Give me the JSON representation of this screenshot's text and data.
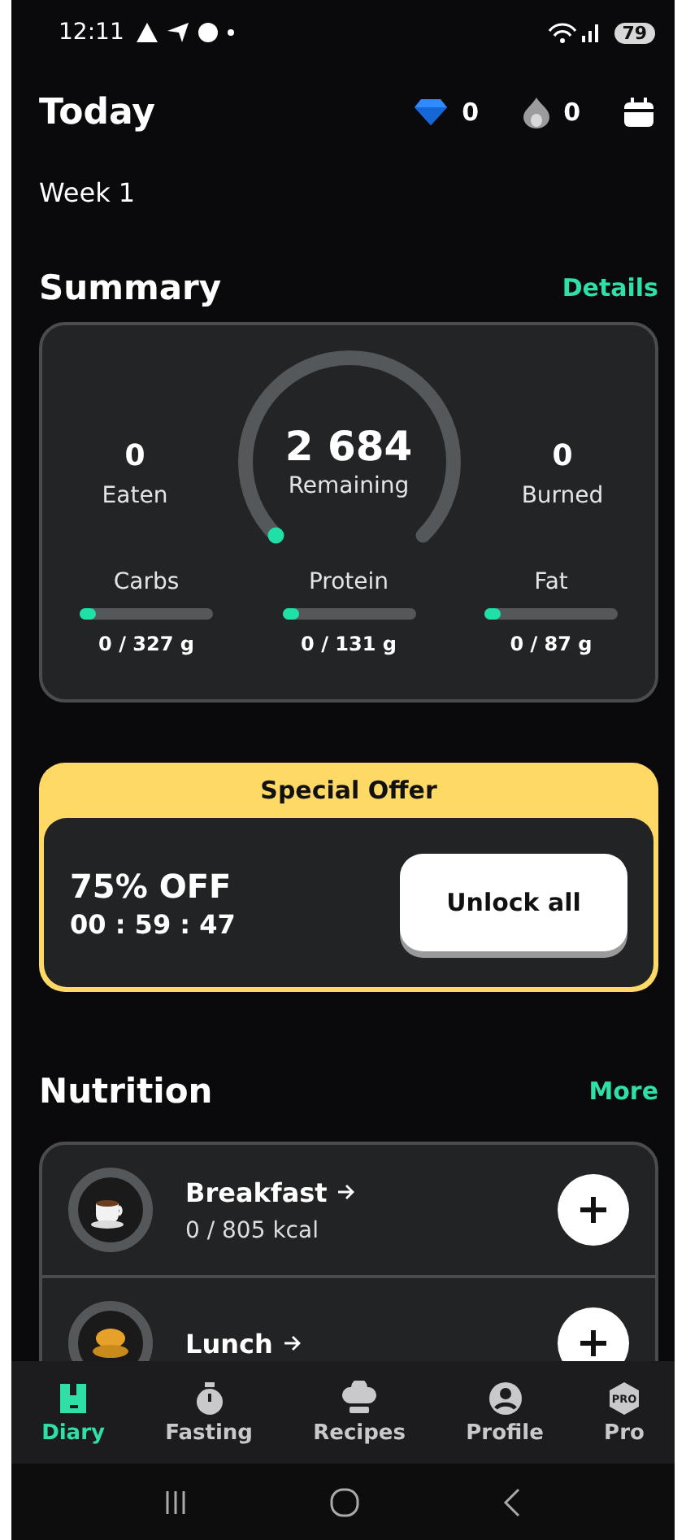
{
  "status_bar": {
    "time": "12:11",
    "battery": "79"
  },
  "header": {
    "title": "Today",
    "gems": "0",
    "streak": "0"
  },
  "week": "Week 1",
  "summary": {
    "title": "Summary",
    "link": "Details",
    "eaten": {
      "value": "0",
      "label": "Eaten"
    },
    "remaining": {
      "value": "2 684",
      "label": "Remaining"
    },
    "burned": {
      "value": "0",
      "label": "Burned"
    },
    "macros": [
      {
        "name": "Carbs",
        "level": 0,
        "reading": "0 / 327 g"
      },
      {
        "name": "Protein",
        "level": 0,
        "reading": "0 / 131 g"
      },
      {
        "name": "Fat",
        "level": 0,
        "reading": "0 / 87 g"
      }
    ]
  },
  "offer": {
    "title": "Special Offer",
    "discount": "75% OFF",
    "timer": "00 : 59 : 47",
    "button": "Unlock all"
  },
  "nutrition": {
    "title": "Nutrition",
    "link": "More",
    "meals": [
      {
        "name": "Breakfast",
        "kcal": "0 / 805 kcal",
        "kind": "coffee"
      },
      {
        "name": "Lunch",
        "kind": "lunch"
      }
    ]
  },
  "tabs": [
    {
      "label": "Diary",
      "kind": "diary",
      "selected": true
    },
    {
      "label": "Fasting",
      "kind": "timer",
      "selected": false
    },
    {
      "label": "Recipes",
      "kind": "chef",
      "selected": false
    },
    {
      "label": "Profile",
      "kind": "person",
      "selected": false
    },
    {
      "label": "Pro",
      "kind": "pro",
      "icon_text": "PRO",
      "selected": false
    }
  ]
}
